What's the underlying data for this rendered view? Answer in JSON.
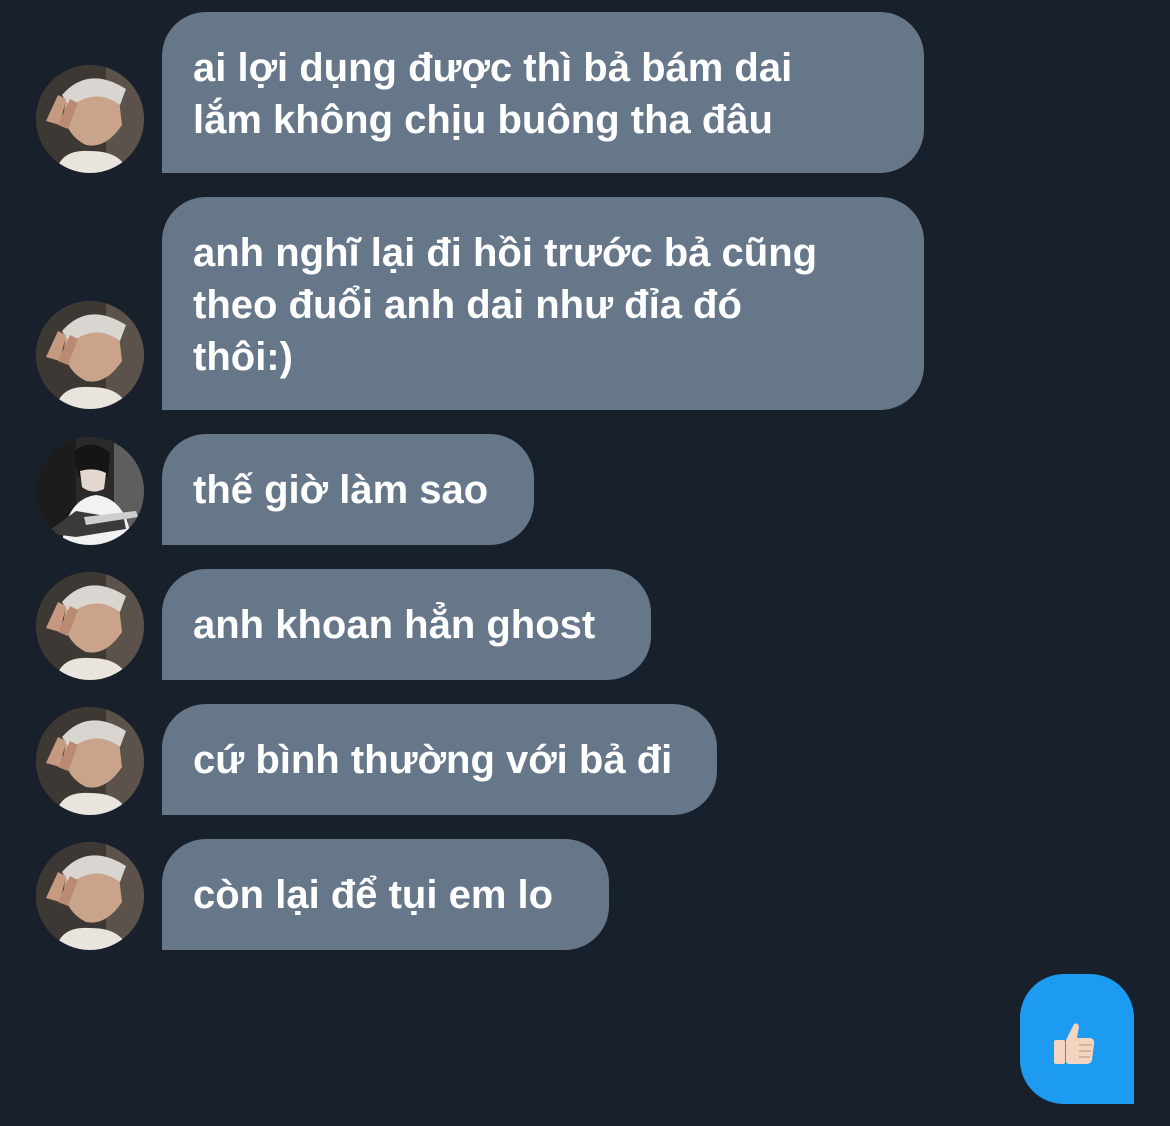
{
  "messages": [
    {
      "lines": [
        "ai lợi dụng được thì bả bám dai",
        "lắm không chịu buông tha đâu"
      ],
      "avatar": "friend-avatar"
    },
    {
      "lines": [
        "anh nghĩ lại đi hồi trước bả cũng",
        "theo đuổi anh dai như đỉa đó",
        "thôi:)"
      ],
      "avatar": "friend-avatar"
    },
    {
      "lines": [
        "thế giờ làm sao"
      ],
      "avatar": "guitar-avatar"
    },
    {
      "lines": [
        "anh khoan hẳn ghost"
      ],
      "avatar": "friend-avatar"
    },
    {
      "lines": [
        "cứ bình thường với bả đi"
      ],
      "avatar": "friend-avatar"
    },
    {
      "lines": [
        "còn lại để tụi em lo"
      ],
      "avatar": "friend-avatar"
    }
  ],
  "sent": {
    "icon": "thumbs-up-icon",
    "glyph": "👍🏻"
  },
  "colors": {
    "background": "#17202b",
    "received_bubble": "#66778a",
    "sent_bubble": "#1d9bf0",
    "text": "#ffffff"
  }
}
